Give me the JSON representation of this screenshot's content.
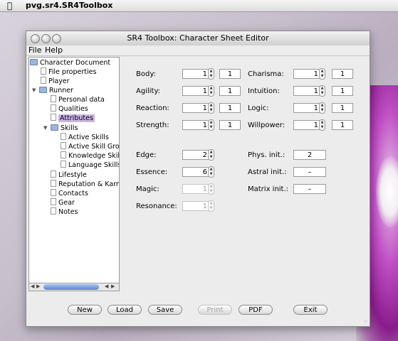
{
  "menubar": {
    "apple": "",
    "app_name": "pvg.sr4.SR4Toolbox"
  },
  "window": {
    "title": "SR4 Toolbox: Character Sheet Editor"
  },
  "menus": [
    "File",
    "Help"
  ],
  "tree": {
    "root": "Character Document",
    "file_properties": "File properties",
    "player": "Player",
    "runner": "Runner",
    "personal_data": "Personal data",
    "qualities": "Qualities",
    "attributes": "Attributes",
    "skills": "Skills",
    "active_skills": "Active Skills",
    "active_skill_groups": "Active Skill Group",
    "knowledge_skills": "Knowledge Skills",
    "language_skills": "Language Skills",
    "lifestyle": "Lifestyle",
    "reputation_karma": "Reputation & Karma",
    "contacts": "Contacts",
    "gear": "Gear",
    "notes": "Notes"
  },
  "attributes_left": [
    {
      "label": "Body:",
      "base": "1",
      "value": "1"
    },
    {
      "label": "Agility:",
      "base": "1",
      "value": "1"
    },
    {
      "label": "Reaction:",
      "base": "1",
      "value": "1"
    },
    {
      "label": "Strength:",
      "base": "1",
      "value": "1"
    }
  ],
  "attributes_right": [
    {
      "label": "Charisma:",
      "base": "1",
      "value": "1"
    },
    {
      "label": "Intuition:",
      "base": "1",
      "value": "1"
    },
    {
      "label": "Logic:",
      "base": "1",
      "value": "1"
    },
    {
      "label": "Willpower:",
      "base": "1",
      "value": "1"
    }
  ],
  "special": {
    "edge_label": "Edge:",
    "edge": "2",
    "essence_label": "Essence:",
    "essence": "6",
    "magic_label": "Magic:",
    "magic": "1",
    "resonance_label": "Resonance:",
    "resonance": "1"
  },
  "initiative": {
    "phys_label": "Phys. init.:",
    "phys": "2",
    "astral_label": "Astral init.:",
    "astral": "–",
    "matrix_label": "Matrix init.:",
    "matrix": "–"
  },
  "buttons": {
    "new": "New",
    "load": "Load",
    "save": "Save",
    "print": "Print",
    "pdf": "PDF",
    "exit": "Exit"
  },
  "colors": {
    "selection": "#cdb3e6",
    "scroll_thumb": "#5a86cf",
    "desktop_accent": "#8a1c8c"
  }
}
